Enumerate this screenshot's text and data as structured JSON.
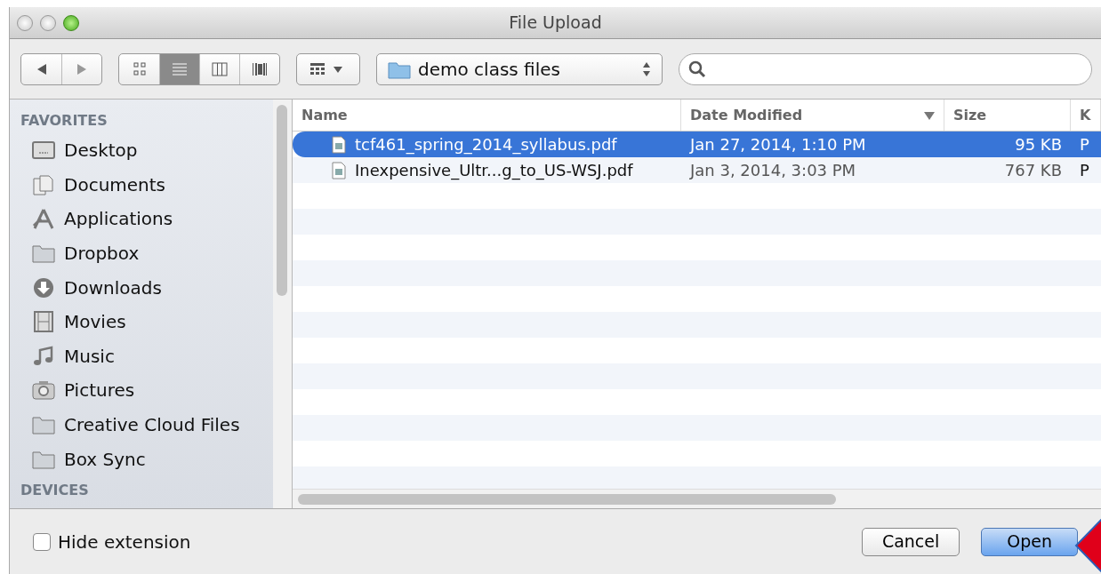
{
  "window": {
    "title": "File Upload"
  },
  "toolbar": {
    "view_modes": [
      {
        "selected": false
      },
      {
        "selected": true
      },
      {
        "selected": false
      },
      {
        "selected": false
      }
    ],
    "location": "demo class files"
  },
  "sidebar": {
    "sections": [
      {
        "heading": "FAVORITES",
        "items": [
          {
            "label": "Desktop",
            "kind": "desktop"
          },
          {
            "label": "Documents",
            "kind": "documents"
          },
          {
            "label": "Applications",
            "kind": "applications"
          },
          {
            "label": "Dropbox",
            "kind": "folder"
          },
          {
            "label": "Downloads",
            "kind": "downloads"
          },
          {
            "label": "Movies",
            "kind": "movies"
          },
          {
            "label": "Music",
            "kind": "music"
          },
          {
            "label": "Pictures",
            "kind": "pictures"
          },
          {
            "label": "Creative Cloud Files",
            "kind": "folder"
          },
          {
            "label": "Box Sync",
            "kind": "folder"
          }
        ]
      },
      {
        "heading": "DEVICES"
      }
    ]
  },
  "table": {
    "columns": [
      {
        "label": "Name",
        "sorted": false
      },
      {
        "label": "Date Modified",
        "sorted": true
      },
      {
        "label": "Size",
        "sorted": false
      },
      {
        "label": "K",
        "sorted": false
      }
    ],
    "rows": [
      {
        "name": "tcf461_spring_2014_syllabus.pdf",
        "date": "Jan 27, 2014, 1:10 PM",
        "size": "95 KB",
        "column_4": "P",
        "selected": true
      },
      {
        "name": "Inexpensive_Ultr...g_to_US-WSJ.pdf",
        "date": "Jan 3, 2014, 3:03 PM",
        "size": "767 KB",
        "column_4": "P",
        "selected": false
      }
    ]
  },
  "footer": {
    "hide_extension": {
      "label": "Hide extension",
      "checked": false
    },
    "buttons": [
      {
        "label": "Cancel",
        "default": false
      },
      {
        "label": "Open",
        "default": true
      }
    ]
  }
}
